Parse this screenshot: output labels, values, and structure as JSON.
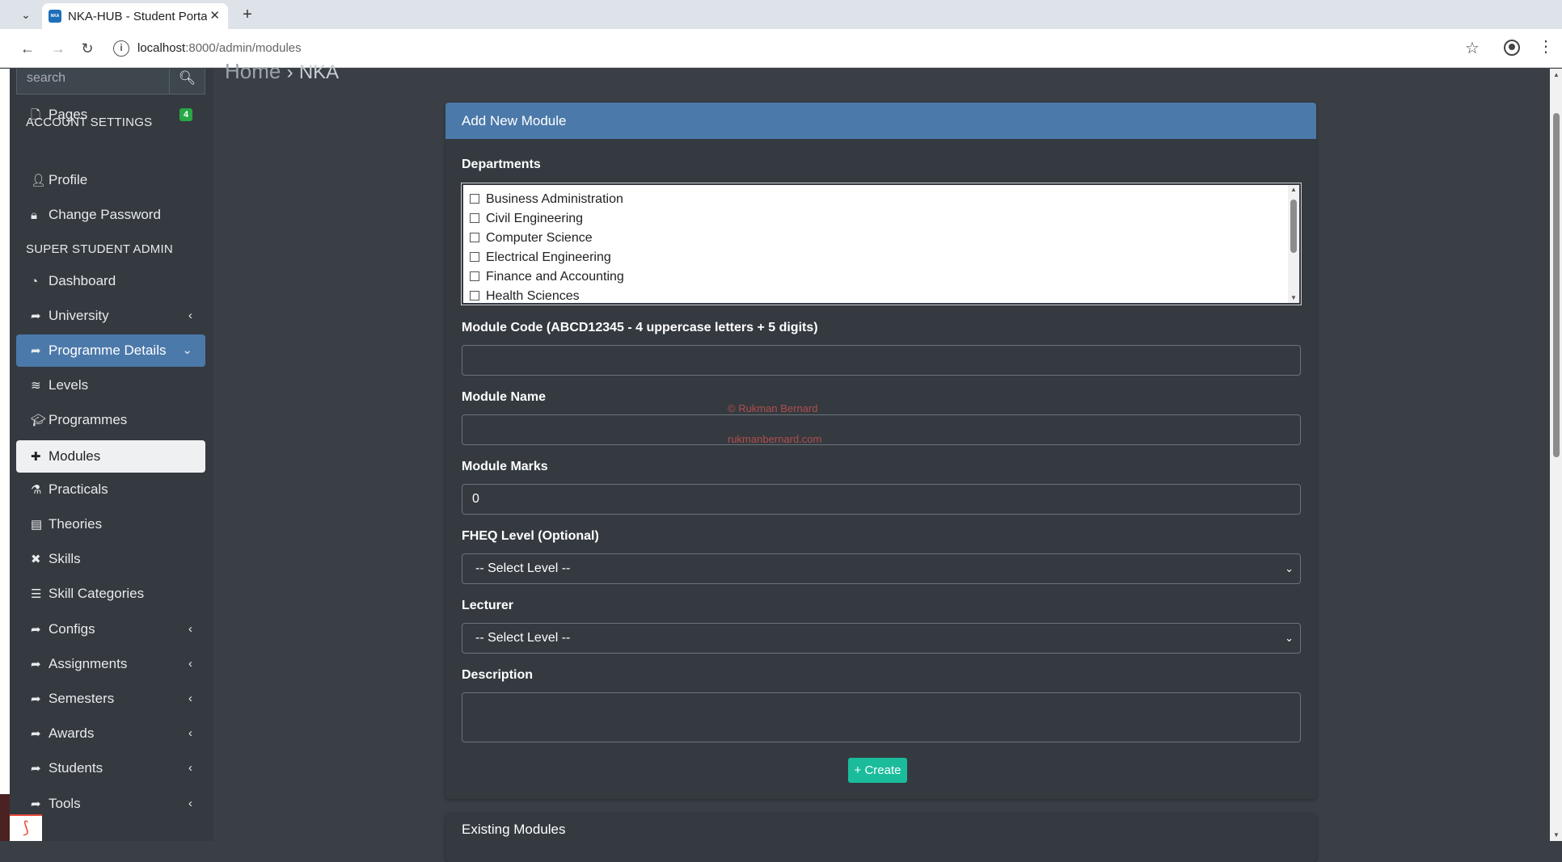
{
  "browser": {
    "tab_title": "NKA-HUB - Student Portal",
    "favicon_text": "NKA",
    "url_host": "localhost",
    "url_path": ":8000/admin/modules"
  },
  "sidebar": {
    "search_placeholder": "search",
    "pages": {
      "label": "Pages",
      "badge": "4"
    },
    "account_settings_header": "ACCOUNT SETTINGS",
    "profile": "Profile",
    "change_password": "Change Password",
    "super_admin_header": "SUPER STUDENT ADMIN",
    "dashboard": "Dashboard",
    "university": "University",
    "programme_details": "Programme Details",
    "levels": "Levels",
    "programmes": "Programmes",
    "modules": "Modules",
    "practicals": "Practicals",
    "theories": "Theories",
    "skills": "Skills",
    "skill_categories": "Skill Categories",
    "configs": "Configs",
    "assignments": "Assignments",
    "semesters": "Semesters",
    "awards": "Awards",
    "students": "Students",
    "tools": "Tools"
  },
  "breadcrumb": {
    "home": "Home",
    "separator": "›",
    "current": "NKA"
  },
  "form": {
    "title": "Add New Module",
    "departments_label": "Departments",
    "departments": [
      "Business Administration",
      "Civil Engineering",
      "Computer Science",
      "Electrical Engineering",
      "Finance and Accounting",
      "Health Sciences"
    ],
    "module_code_label": "Module Code (ABCD12345 - 4 uppercase letters + 5 digits)",
    "module_code_value": "",
    "module_name_label": "Module Name",
    "module_name_value": "",
    "module_marks_label": "Module Marks",
    "module_marks_value": "0",
    "fheq_label": "FHEQ Level (Optional)",
    "fheq_selected": "-- Select Level --",
    "lecturer_label": "Lecturer",
    "lecturer_selected": "-- Select Level --",
    "description_label": "Description",
    "description_value": "",
    "create_button": "+ Create"
  },
  "watermark": {
    "line1": "© Rukman Bernard",
    "line2": "rukmanbernard.com"
  },
  "existing": {
    "title": "Existing Modules"
  }
}
